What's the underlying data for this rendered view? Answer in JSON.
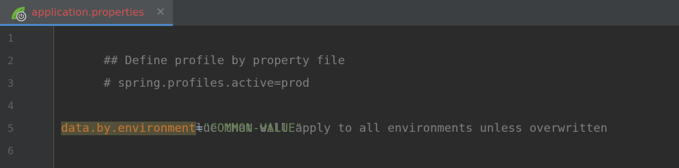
{
  "tab": {
    "filename": "application.properties",
    "icon": "spring-boot-leaf-icon",
    "close_glyph": "✕"
  },
  "editor": {
    "line_numbers": [
      "1",
      "2",
      "3",
      "4",
      "5",
      "6"
    ],
    "lines": {
      "l1": "## Define profile by property file",
      "l2": "# spring.profiles.active=prod",
      "l3": "",
      "l4": "# Property value that will apply to all environments unless overwritten",
      "l5": {
        "key": "data.by.environment",
        "eq": "=",
        "value": "\"COMMON-VALUE\""
      },
      "l6": ""
    }
  },
  "colors": {
    "background": "#2b2b2b",
    "gutter": "#313335",
    "tab_active": "#4e5254",
    "tab_label": "#d25252",
    "comment": "#808080",
    "property_key": "#cc7832",
    "string_value": "#6a8759"
  }
}
